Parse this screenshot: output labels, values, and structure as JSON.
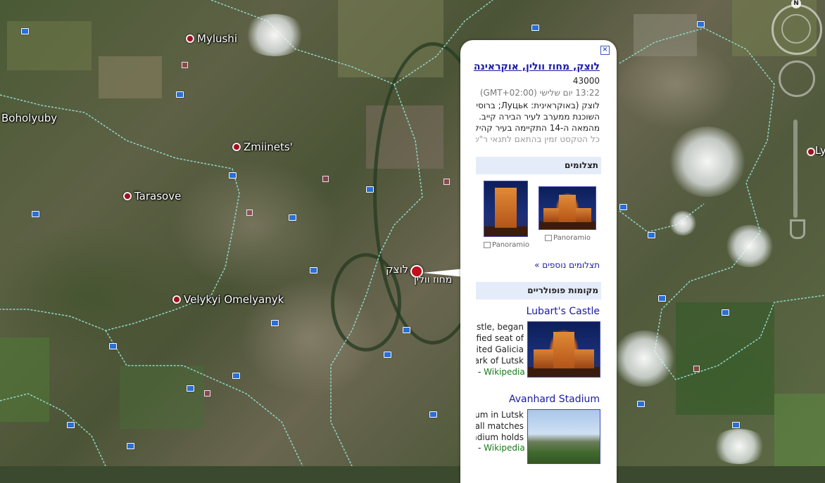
{
  "map": {
    "places": [
      {
        "name": "Mylushi"
      },
      {
        "name": "Boholyuby"
      },
      {
        "name": "Zmiinets'"
      },
      {
        "name": "Tarasove"
      },
      {
        "name": "Velykyi Omelyanyk"
      }
    ],
    "selected_city_label": "לוצק",
    "selected_region_label": "מחוז וולין",
    "right_edge_label": "Ly",
    "compass_north": "N",
    "colors": {
      "place_pin": "#a2101c",
      "selected_pin": "#c0101c",
      "photo_marker": "#2a6fd6"
    }
  },
  "balloon": {
    "close_icon": "close-icon",
    "title": "לוצק, מחוז וולין, אוקראינה",
    "postal_code": "43000",
    "time": "13:22 יום שלישי (GMT+02:00)",
    "description_lines": [
      "לוצק (באוקראינית: Луцьк; ברוסית",
      "השוכנת ממערב לעיר הבירה קייב.",
      "מהמאה ה-14 התקיימה בעיר קהילו",
      "כל הטקסט זמין בהתאם לתנאי ר\"ש"
    ],
    "photos_header": "תצלומים",
    "photos": [
      {
        "caption": "Panoramio"
      },
      {
        "caption": "Panoramio"
      }
    ],
    "more_photos_link": "תצלומים נוספים »",
    "popular_header": "מקומות פופולריים",
    "popular": [
      {
        "title": "Lubart's Castle",
        "snippet_lines": [
          "astle, began",
          "tified seat of",
          "ited Galicia-",
          "ark of Lutsk,"
        ],
        "source_prefix": "- ",
        "source": "Wikipedia"
      },
      {
        "title": "Avanhard Stadium",
        "snippet_lines": [
          "um in Lutsk,",
          "all matches,",
          "adium holds"
        ],
        "source_prefix": "- ",
        "source": "Wikipedia"
      }
    ]
  }
}
